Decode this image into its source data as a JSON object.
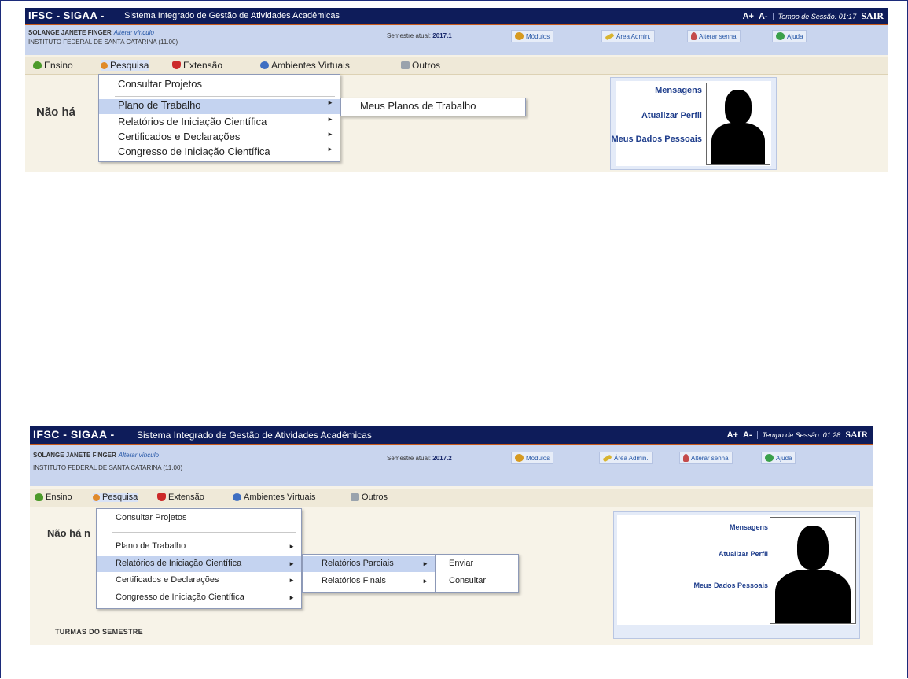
{
  "header": {
    "brand": "IFSC - SIGAA -",
    "system_name": "Sistema Integrado de Gestão de Atividades Acadêmicas",
    "font_increase": "A+",
    "font_decrease": "A-",
    "exit": "SAIR"
  },
  "user": {
    "name": "SOLANGE JANETE FINGER",
    "change_link": "Alterar vínculo",
    "institution": "INSTITUTO FEDERAL DE SANTA CATARINA (11.00)"
  },
  "toolbar": {
    "modules": "Módulos",
    "admin": "Área Admin.",
    "change_password": "Alterar senha",
    "help": "Ajuda"
  },
  "menu_bar": {
    "ensino": "Ensino",
    "pesquisa": "Pesquisa",
    "extensao": "Extensão",
    "ambientes": "Ambientes Virtuais",
    "outros": "Outros"
  },
  "pesquisa_menu": {
    "consultar": "Consultar Projetos",
    "plano": "Plano de Trabalho",
    "relatorios": "Relatórios de Iniciação Científica",
    "certificados": "Certificados e Declarações",
    "congresso": "Congresso de Iniciação Científica"
  },
  "side_panel": {
    "mensagens": "Mensagens",
    "atualizar": "Atualizar Perfil",
    "dados": "Meus Dados Pessoais"
  },
  "screen1": {
    "session_time": "Tempo de Sessão: 01:17",
    "semester": "2017.1",
    "semester_label": "Semestre atual:",
    "no_content_msg": "Não há",
    "submenu_plano": "Meus Planos de Trabalho"
  },
  "screen2": {
    "session_time": "Tempo de Sessão: 01:28",
    "semester": "2017.2",
    "semester_label": "Semestre atual:",
    "no_content_msg": "Não há n",
    "submenu_relatorios": {
      "parciais": "Relatórios Parciais",
      "finais": "Relatórios Finais"
    },
    "submenu_parciais": {
      "enviar": "Enviar",
      "consultar": "Consultar"
    },
    "turmas_heading": "TURMAS DO SEMESTRE"
  },
  "colors": {
    "title_bar": "#0e1c5a",
    "user_bar": "#c9d5ee",
    "menu_highlight": "#c4d3f0",
    "link": "#1f3e8c"
  }
}
